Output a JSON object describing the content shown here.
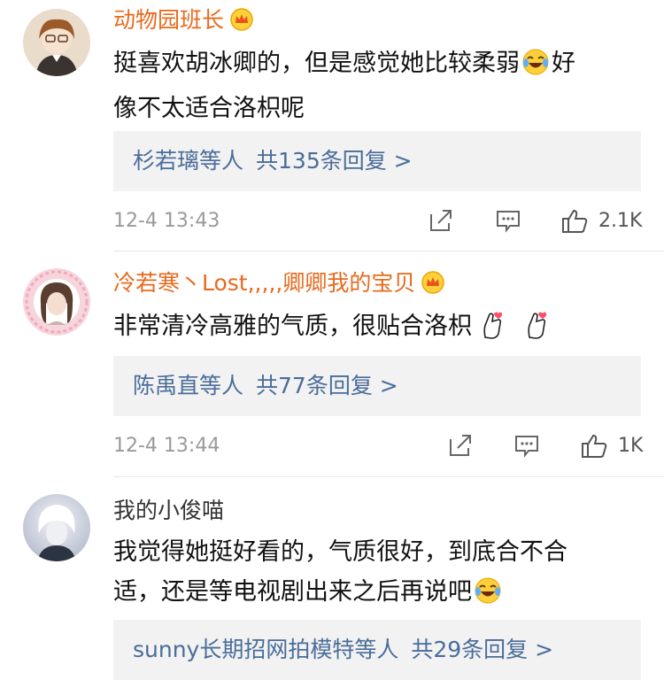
{
  "comments": [
    {
      "username": "动物园班长",
      "text_line1": "挺喜欢胡冰卿的，但是感觉她比较柔弱",
      "text_line1_tail": "好",
      "text_line2": "像不太适合洛枳呢",
      "reply_who": "杉若璃等人",
      "reply_count": "共135条回复 >",
      "time": "12-4 13:43",
      "likes": "2.1K",
      "vip": true
    },
    {
      "username": "冷若寒丶Lost,,,,,卿卿我的宝贝",
      "text_line1": "非常清冷高雅的气质，很贴合洛枳",
      "reply_who": "陈禹直等人",
      "reply_count": "共77条回复 >",
      "time": "12-4 13:44",
      "likes": "1K",
      "vip": true
    },
    {
      "username": "我的小俊喵",
      "text_line1": "我觉得她挺好看的，气质很好，到底合不合",
      "text_line2": "适，还是等电视剧出来之后再说吧",
      "reply_who": "sunny长期招网拍模特等人",
      "reply_count": "共29条回复 >",
      "vip": false
    }
  ],
  "icons": {
    "crown": "crown-icon",
    "laugh_cry": "laughing-crying-emoji-icon",
    "finger_heart": "finger-heart-emoji-icon",
    "share": "share-icon",
    "comment": "comment-icon",
    "like": "thumbs-up-icon"
  },
  "colors": {
    "vip_name": "#e86a1d",
    "link": "#4a6d9a"
  }
}
